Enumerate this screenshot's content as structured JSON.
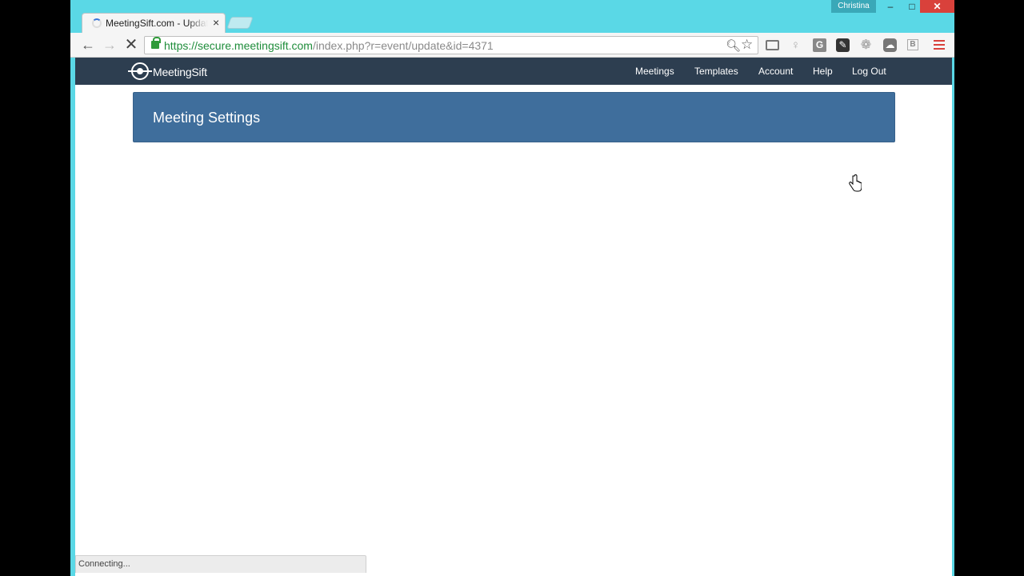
{
  "browser": {
    "tab_title": "MeetingSift.com - Update",
    "tab_close": "×",
    "profile_name": "Christina",
    "window_min": "–",
    "window_max": "□",
    "window_close": "✕",
    "nav_back": "←",
    "nav_forward": "→",
    "nav_stop": "✕",
    "url_host": "https://secure.meetingsift.com",
    "url_path": "/index.php?r=event/update&id=4371",
    "zoom_icon": "magnifier-icon",
    "star_icon": "star-icon",
    "ext_g": "G",
    "ext_b": "B",
    "ext_gear": "❁",
    "ext_bulb": "♀",
    "status_text": "Connecting..."
  },
  "site": {
    "logo_text": "MeetingSift",
    "menu": [
      "Meetings",
      "Templates",
      "Account",
      "Help",
      "Log Out"
    ],
    "banner_title": "Meeting Settings"
  },
  "colors": {
    "window_frame": "#5ad8e6",
    "site_nav": "#2d3e50",
    "banner": "#3f6e9c",
    "url_host": "#1f8d3b",
    "close_button": "#d9413b"
  }
}
